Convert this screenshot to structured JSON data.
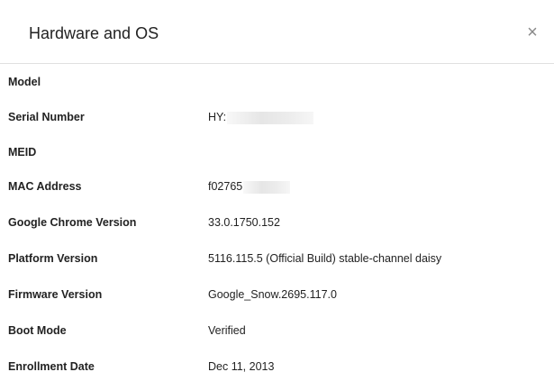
{
  "dialog": {
    "title": "Hardware and OS",
    "close_glyph": "×"
  },
  "rows": [
    {
      "label": "Model",
      "value": ""
    },
    {
      "label": "Serial Number",
      "value": "HY:"
    },
    {
      "label": "MEID",
      "value": ""
    },
    {
      "label": "MAC Address",
      "value": "f02765"
    },
    {
      "label": "Google Chrome Version",
      "value": "33.0.1750.152"
    },
    {
      "label": "Platform Version",
      "value": "5116.115.5 (Official Build) stable-channel daisy"
    },
    {
      "label": "Firmware Version",
      "value": "Google_Snow.2695.117.0"
    },
    {
      "label": "Boot Mode",
      "value": "Verified"
    },
    {
      "label": "Enrollment Date",
      "value": "Dec 11, 2013"
    }
  ],
  "colors": {
    "background": "#ffffff",
    "text": "#222222",
    "divider": "#e0e0e0",
    "close_icon": "#8a8a8a"
  }
}
